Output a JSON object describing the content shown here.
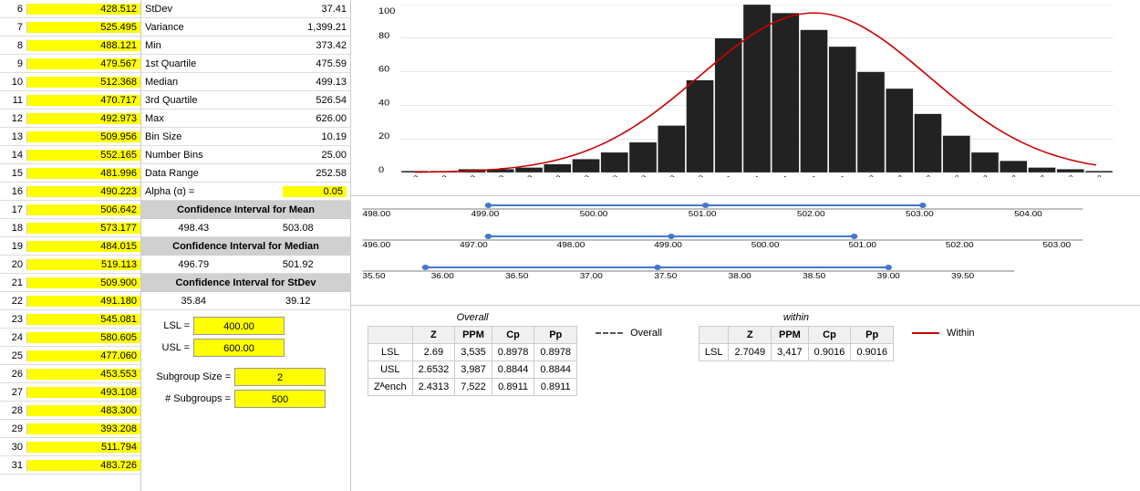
{
  "rows": [
    {
      "num": 6,
      "val": "428.512"
    },
    {
      "num": 7,
      "val": "525.495"
    },
    {
      "num": 8,
      "val": "488.121"
    },
    {
      "num": 9,
      "val": "479.567"
    },
    {
      "num": 10,
      "val": "512.368"
    },
    {
      "num": 11,
      "val": "470.717"
    },
    {
      "num": 12,
      "val": "492.973"
    },
    {
      "num": 13,
      "val": "509.956"
    },
    {
      "num": 14,
      "val": "552.165"
    },
    {
      "num": 15,
      "val": "481.996"
    },
    {
      "num": 16,
      "val": "490.223"
    },
    {
      "num": 17,
      "val": "506.642"
    },
    {
      "num": 18,
      "val": "573.177"
    },
    {
      "num": 19,
      "val": "484.015"
    },
    {
      "num": 20,
      "val": "519.113"
    },
    {
      "num": 21,
      "val": "509.900"
    },
    {
      "num": 22,
      "val": "491.180"
    },
    {
      "num": 23,
      "val": "545.081"
    },
    {
      "num": 24,
      "val": "580.605"
    },
    {
      "num": 25,
      "val": "477.060"
    },
    {
      "num": 26,
      "val": "453.553"
    },
    {
      "num": 27,
      "val": "493.108"
    },
    {
      "num": 28,
      "val": "483.300"
    },
    {
      "num": 29,
      "val": "393.208"
    },
    {
      "num": 30,
      "val": "511.794"
    },
    {
      "num": 31,
      "val": "483.726"
    }
  ],
  "stats": [
    {
      "label": "StDev",
      "value": "37.41"
    },
    {
      "label": "Variance",
      "value": "1,399.21"
    },
    {
      "label": "Min",
      "value": "373.42"
    },
    {
      "label": "1st Quartile",
      "value": "475.59"
    },
    {
      "label": "Median",
      "value": "499.13"
    },
    {
      "label": "3rd Quartile",
      "value": "526.54"
    },
    {
      "label": "Max",
      "value": "626.00"
    },
    {
      "label": "Bin Size",
      "value": "10.19"
    },
    {
      "label": "Number Bins",
      "value": "25.00"
    },
    {
      "label": "Data Range",
      "value": "252.58"
    }
  ],
  "alpha": {
    "label": "Alpha (α) =",
    "value": "0.05"
  },
  "ci_mean": {
    "header": "Confidence Interval for Mean",
    "low": "498.43",
    "high": "503.08"
  },
  "ci_median": {
    "header": "Confidence Interval for Median",
    "low": "496.79",
    "high": "501.92"
  },
  "ci_stdev": {
    "header": "Confidence Interval for StDev",
    "low": "35.84",
    "high": "39.12"
  },
  "lsl": {
    "label": "LSL =",
    "value": "400.00"
  },
  "usl": {
    "label": "USL =",
    "value": "600.00"
  },
  "subgroup_size": {
    "label": "Subgroup Size =",
    "value": "2"
  },
  "num_subgroups": {
    "label": "# Subgroups =",
    "value": "500"
  },
  "histogram": {
    "x_labels": [
      "379",
      "389",
      "399",
      "409",
      "419",
      "429",
      "440",
      "450",
      "460",
      "470",
      "480",
      "491",
      "501",
      "511",
      "521",
      "531",
      "542",
      "552",
      "562",
      "572",
      "582",
      "593",
      "603",
      "613",
      "623"
    ],
    "bars": [
      1,
      1,
      2,
      2,
      3,
      5,
      8,
      12,
      18,
      28,
      55,
      80,
      100,
      95,
      85,
      75,
      60,
      50,
      35,
      22,
      12,
      7,
      3,
      2,
      1
    ],
    "y_labels": [
      "0",
      "20",
      "40",
      "60",
      "80",
      "100"
    ]
  },
  "ci_mean_axis": {
    "points": [
      "498.00",
      "499.00",
      "500.00",
      "501.00",
      "502.00",
      "503.00",
      "504.00"
    ]
  },
  "ci_median_axis": {
    "points": [
      "496.00",
      "497.00",
      "498.00",
      "499.00",
      "500.00",
      "501.00",
      "502.00",
      "503.00"
    ]
  },
  "ci_stdev_axis": {
    "points": [
      "35.50",
      "36.00",
      "36.50",
      "37.00",
      "37.50",
      "38.00",
      "38.50",
      "39.00",
      "39.50"
    ]
  },
  "overall_table": {
    "title": "Overall",
    "headers": [
      "",
      "Z",
      "PPM",
      "Cp",
      "Pp"
    ],
    "rows": [
      {
        "label": "LSL",
        "z": "2.69",
        "ppm": "3,535",
        "cp": "0.8978",
        "pp": "0.8978"
      },
      {
        "label": "USL",
        "z": "2.6532",
        "ppm": "3,987",
        "cp": "0.8844",
        "pp": "0.8844"
      },
      {
        "label": "Zᴬench",
        "z": "2.4313",
        "ppm": "7,522",
        "cp": "0.8911",
        "pp": "0.8911"
      }
    ]
  },
  "within_table": {
    "title": "within",
    "headers": [
      "",
      "Z",
      "PPM",
      "Cp",
      "Pp"
    ],
    "rows": [
      {
        "label": "LSL",
        "z": "2.7049",
        "ppm": "3,417",
        "cp": "0.9016",
        "pp": "0.9016"
      }
    ]
  },
  "legend": {
    "overall_label": "Overall",
    "within_label": "Within"
  }
}
